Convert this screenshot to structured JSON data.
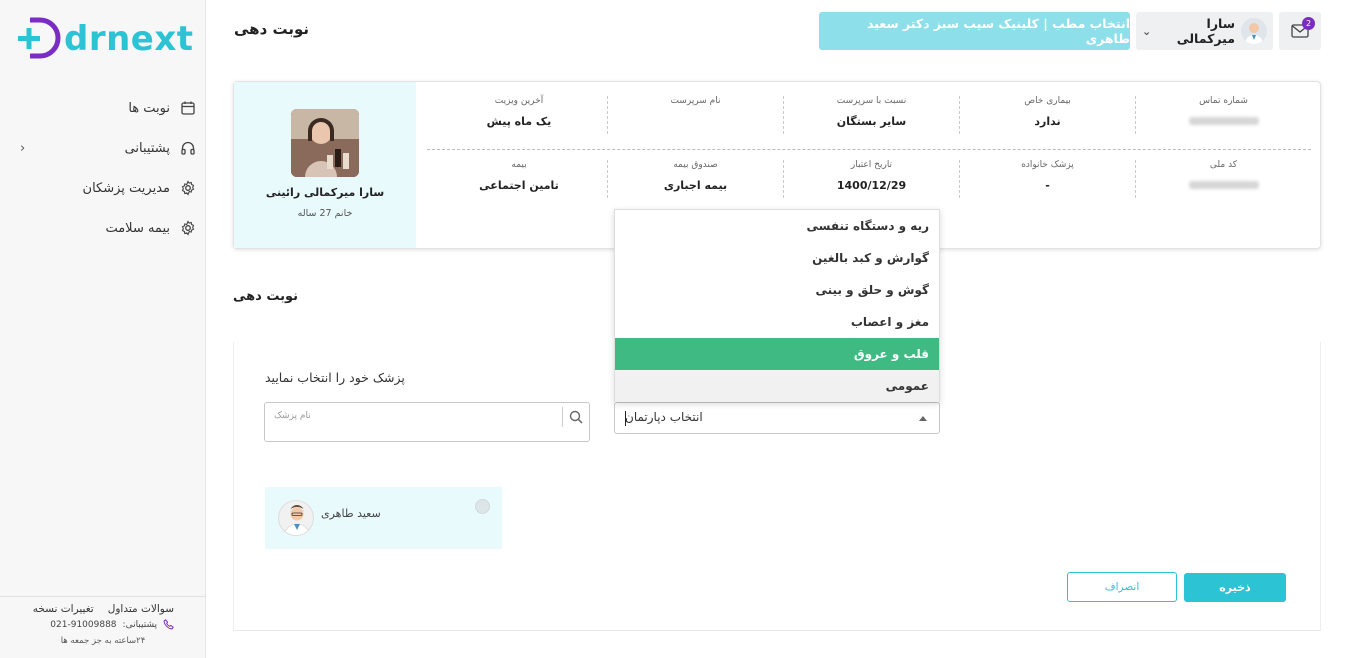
{
  "brand": {
    "logo_text": "drnext",
    "primary_color": "#2cc3d4",
    "accent_color": "#7a2cc4"
  },
  "sidebar": {
    "items": [
      {
        "label": "نوبت ها",
        "icon": "calendar-icon"
      },
      {
        "label": "پشتیبانی",
        "icon": "headphones-icon",
        "has_submenu": true
      },
      {
        "label": "مدیریت پزشکان",
        "icon": "gear-icon"
      },
      {
        "label": "بیمه سلامت",
        "icon": "gear-icon"
      }
    ],
    "footer": {
      "faq": "سوالات متداول",
      "changelog": "تغییرات نسخه",
      "support_label": "پشتیبانی:",
      "support_phone": "021-91009888",
      "hours": "۲۴ساعته به جز جمعه ها"
    }
  },
  "header": {
    "title": "نوبت دهی",
    "clinic_button": "انتخاب مطب | کلینیک سیب سبز دکتر سعید طاهری",
    "user_name": "سارا میرکمالی",
    "mail_count": "2"
  },
  "patient": {
    "name": "سارا میرکمالی رائینی",
    "meta": "خانم 27 ساله",
    "fields_row1": [
      {
        "key": "شماره تماس",
        "value": ""
      },
      {
        "key": "بیماری خاص",
        "value": "ندارد"
      },
      {
        "key": "نسبت با سرپرست",
        "value": "سایر بستگان"
      },
      {
        "key": "نام سرپرست",
        "value": ""
      },
      {
        "key": "آخرین ویزیت",
        "value": "یک ماه پیش"
      }
    ],
    "fields_row2": [
      {
        "key": "کد ملی",
        "value": ""
      },
      {
        "key": "پزشک خانواده",
        "value": "-"
      },
      {
        "key": "تاریخ اعتبار",
        "value": "1400/12/29"
      },
      {
        "key": "صندوق بیمه",
        "value": "بیمه اجباری"
      },
      {
        "key": "بیمه",
        "value": "تامین اجتماعی"
      }
    ]
  },
  "booking": {
    "section_title": "نوبت دهی",
    "doctor_prompt": "پزشک خود را انتخاب نمایید",
    "doctor_search_placeholder": "نام پزشک",
    "department_placeholder": "انتخاب دپارتمان",
    "departments": [
      {
        "label": "ریه و دستگاه تنفسی",
        "state": "normal"
      },
      {
        "label": "گوارش و کبد بالغین",
        "state": "normal"
      },
      {
        "label": "گوش و حلق و بینی",
        "state": "normal"
      },
      {
        "label": "مغز و اعصاب",
        "state": "normal"
      },
      {
        "label": "قلب و عروق",
        "state": "selected"
      },
      {
        "label": "عمومی",
        "state": "hover"
      }
    ],
    "doctor": {
      "name": "سعید طاهری"
    },
    "save_label": "ذخیره",
    "cancel_label": "انصراف"
  }
}
